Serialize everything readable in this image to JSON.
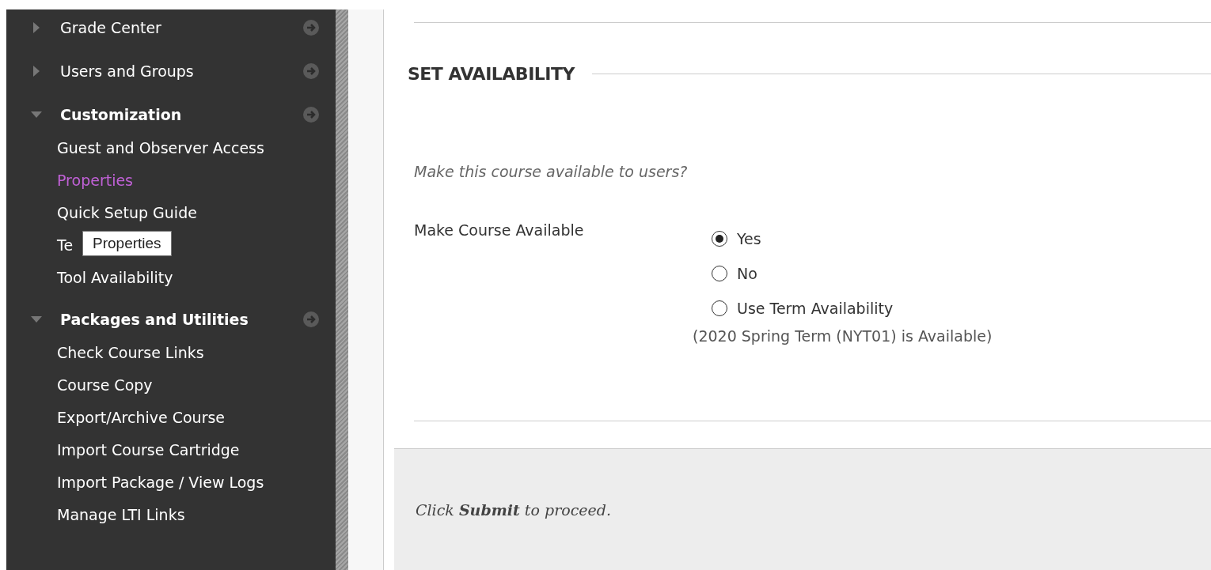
{
  "sidebar": {
    "sections": [
      {
        "title": "Grade Center",
        "expanded": false
      },
      {
        "title": "Users and Groups",
        "expanded": false
      },
      {
        "title": "Customization",
        "expanded": true,
        "items": [
          {
            "label": "Guest and Observer Access",
            "selected": false
          },
          {
            "label": "Properties",
            "selected": true
          },
          {
            "label": "Quick Setup Guide",
            "selected": false
          },
          {
            "label": "Te",
            "selected": false
          },
          {
            "label": "Tool Availability",
            "selected": false
          }
        ]
      },
      {
        "title": "Packages and Utilities",
        "expanded": true,
        "items": [
          {
            "label": "Check Course Links",
            "selected": false
          },
          {
            "label": "Course Copy",
            "selected": false
          },
          {
            "label": "Export/Archive Course",
            "selected": false
          },
          {
            "label": "Import Course Cartridge",
            "selected": false
          },
          {
            "label": "Import Package / View Logs",
            "selected": false
          },
          {
            "label": "Manage LTI Links",
            "selected": false
          }
        ]
      }
    ]
  },
  "tooltip": {
    "text": "Properties"
  },
  "section": {
    "heading": "SET AVAILABILITY",
    "prompt": "Make this course available to users?",
    "field_label": "Make Course Available",
    "options": [
      {
        "label": "Yes",
        "selected": true
      },
      {
        "label": "No",
        "selected": false
      },
      {
        "label": "Use Term Availability",
        "selected": false
      }
    ],
    "note": "(2020 Spring Term (NYT01) is Available)"
  },
  "footer": {
    "text": "Click **Submit** to proceed."
  }
}
